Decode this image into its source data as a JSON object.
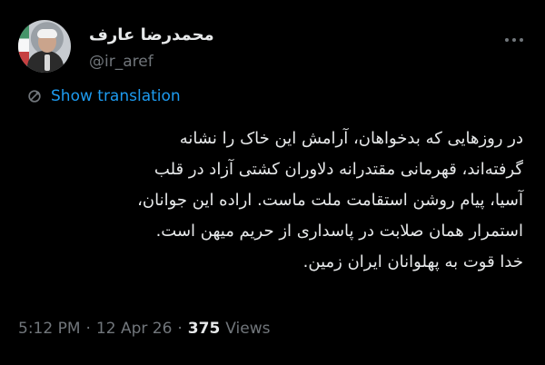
{
  "author": {
    "display_name": "محمدرضا عارف",
    "handle": "@ir_aref"
  },
  "actions": {
    "more_icon": "more-horizontal-icon"
  },
  "translation": {
    "label": "Show translation",
    "icon": "translate-icon"
  },
  "tweet": {
    "lines": [
      "در روزهایی که بدخواهان، آرامش این خاک را نشانه",
      "گرفته‌اند، قهرمانی مقتدرانه دلاوران کشتی آزاد در قلب",
      "آسیا، پیام روشن استقامت ملت ماست. اراده این جوانان،",
      "استمرار همان صلابت در پاسداری از حریم میهن است.",
      "خدا قوت به پهلوانان ایران زمین."
    ]
  },
  "meta": {
    "time": "5:12 PM",
    "separator1": "·",
    "date": "12 Apr 26",
    "separator2": "·",
    "views_count": "375",
    "views_label": "Views"
  },
  "colors": {
    "background": "#000000",
    "text": "#e7e9ea",
    "muted": "#71767b",
    "accent": "#1d9bf0"
  }
}
